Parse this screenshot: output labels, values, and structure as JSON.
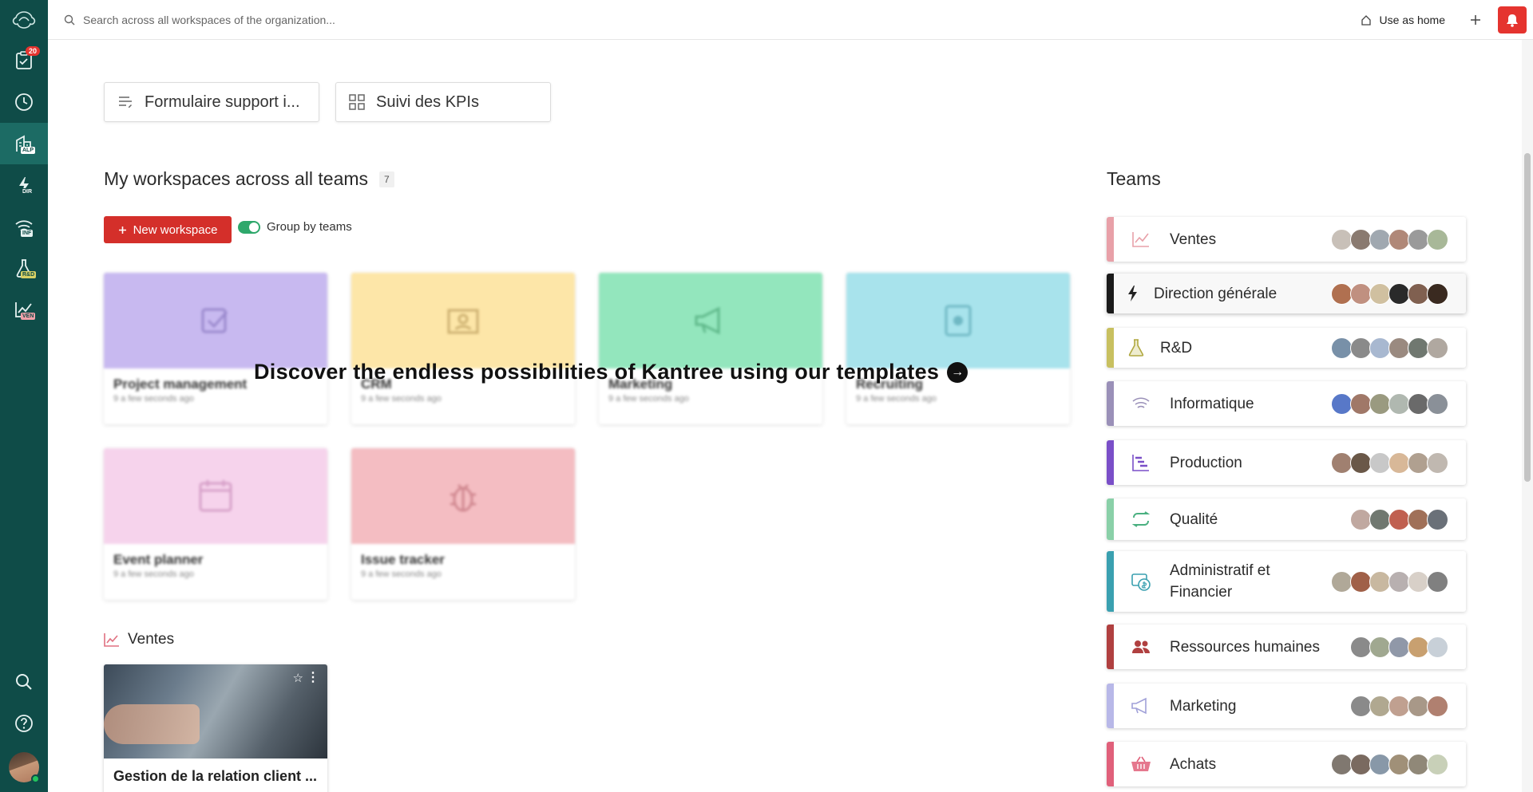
{
  "sidebar": {
    "notifications_count": "20",
    "items": [
      {
        "name": "tasks",
        "tag": ""
      },
      {
        "name": "history",
        "tag": ""
      },
      {
        "name": "alp",
        "tag": "ALP",
        "tag_color": "#ffffff",
        "tag_bg": "#1c6b64"
      },
      {
        "name": "dir",
        "tag": "DIR"
      },
      {
        "name": "inf",
        "tag": "INF"
      },
      {
        "name": "rd",
        "tag": "R&D"
      },
      {
        "name": "ven",
        "tag": "VEN"
      }
    ]
  },
  "topbar": {
    "search_placeholder": "Search across all workspaces of the organization...",
    "use_as_home": "Use as home"
  },
  "quick_access": [
    {
      "label": "Formulaire support i...",
      "icon": "form-icon"
    },
    {
      "label": "Suivi des KPIs",
      "icon": "dashboard-icon"
    }
  ],
  "workspaces": {
    "heading": "My workspaces across all teams",
    "count": "7",
    "new_button": "New workspace",
    "group_by_label": "Group by teams",
    "group_by_on": true
  },
  "templates": {
    "banner": "Discover the endless possibilities of Kantree using our templates",
    "items": [
      {
        "name": "Project management",
        "sub": "9 a few seconds ago",
        "color": "#c8b9f0",
        "icon": "checkbox-icon"
      },
      {
        "name": "CRM",
        "sub": "9 a few seconds ago",
        "color": "#fde6a8",
        "icon": "contact-icon"
      },
      {
        "name": "Marketing",
        "sub": "9 a few seconds ago",
        "color": "#93e6bd",
        "icon": "megaphone-icon"
      },
      {
        "name": "Recruiting",
        "sub": "9 a few seconds ago",
        "color": "#a8e3ec",
        "icon": "badge-icon"
      },
      {
        "name": "Event planner",
        "sub": "9 a few seconds ago",
        "color": "#f6d3ec",
        "icon": "calendar-icon"
      },
      {
        "name": "Issue tracker",
        "sub": "9 a few seconds ago",
        "color": "#f4bdc2",
        "icon": "bug-icon"
      }
    ]
  },
  "sections": [
    {
      "title": "Ventes",
      "workspaces": [
        {
          "title": "Gestion de la relation client ..."
        }
      ]
    }
  ],
  "teams": {
    "heading": "Teams",
    "items": [
      {
        "name": "Ventes",
        "color": "#e8a0a8",
        "icon": "chart-line-icon",
        "avatars": 6
      },
      {
        "name": "Direction générale",
        "color": "#1a1a1a",
        "icon": "bolt-icon",
        "avatars": 6,
        "selected": true
      },
      {
        "name": "R&D",
        "color": "#c8c060",
        "icon": "flask-icon",
        "avatars": 6
      },
      {
        "name": "Informatique",
        "color": "#9a90b8",
        "icon": "wifi-icon",
        "avatars": 6
      },
      {
        "name": "Production",
        "color": "#7a4fc8",
        "icon": "gantt-icon",
        "avatars": 6
      },
      {
        "name": "Qualité",
        "color": "#8ad0a8",
        "icon": "cycle-icon",
        "avatars": 5
      },
      {
        "name": "Administratif et Financier",
        "color": "#3aa0b0",
        "icon": "money-icon",
        "avatars": 6
      },
      {
        "name": "Ressources humaines",
        "color": "#b04040",
        "icon": "people-icon",
        "avatars": 5
      },
      {
        "name": "Marketing",
        "color": "#b8b8e8",
        "icon": "megaphone-icon",
        "avatars": 5
      },
      {
        "name": "Achats",
        "color": "#e0607a",
        "icon": "basket-icon",
        "avatars": 6
      }
    ]
  }
}
